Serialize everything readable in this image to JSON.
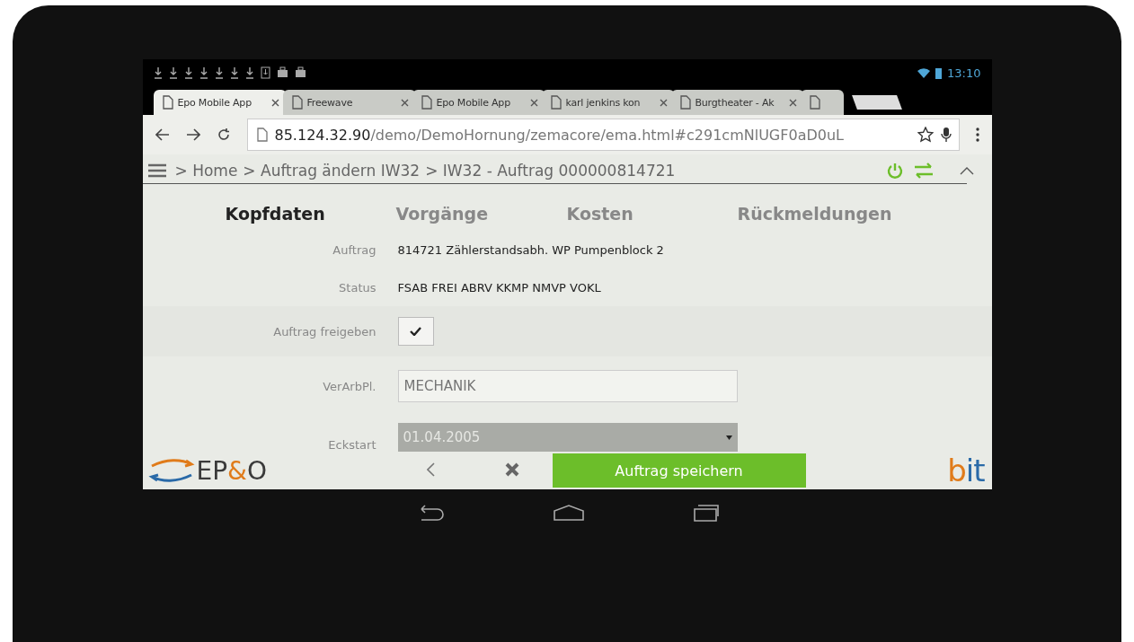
{
  "status_bar": {
    "time": "13:10"
  },
  "tabs": [
    {
      "label": "Epo Mobile App",
      "selected": true
    },
    {
      "label": "Freewave",
      "selected": false
    },
    {
      "label": "Epo Mobile App",
      "selected": false
    },
    {
      "label": "karl jenkins kon",
      "selected": false
    },
    {
      "label": "Burgtheater - Ak",
      "selected": false
    }
  ],
  "address_bar": {
    "host": "85.124.32.90",
    "path": "/demo/DemoHornung/zemacore/ema.html#c291cmNlUGF0aD0uL"
  },
  "breadcrumb": [
    "> Home",
    "> Auftrag ändern IW32",
    "> IW32 - Auftrag 000000814721"
  ],
  "sections": [
    {
      "label": "Kopfdaten",
      "selected": true
    },
    {
      "label": "Vorgänge",
      "selected": false
    },
    {
      "label": "Kosten",
      "selected": false
    },
    {
      "label": "Rückmeldungen",
      "selected": false
    }
  ],
  "fields": [
    {
      "kind": "text",
      "label": "Auftrag",
      "value": "814721 Zählerstandsabh. WP Pumpenblock 2"
    },
    {
      "kind": "text",
      "label": "Status",
      "value": "FSAB FREI ABRV KKMP NMVP VOKL"
    },
    {
      "kind": "checkbox",
      "label": "Auftrag freigeben",
      "checked": true
    },
    {
      "kind": "input",
      "label": "VerArbPl.",
      "placeholder": "MECHANIK"
    },
    {
      "kind": "select",
      "label": "Eckstart",
      "value": "01.04.2005",
      "disabled": true
    }
  ],
  "footer": {
    "logo_left": [
      {
        "text": "EP",
        "kind": "dark"
      },
      {
        "text": "&",
        "kind": "accent"
      },
      {
        "text": "O",
        "kind": "dark"
      }
    ],
    "save_button": "Auftrag speichern",
    "logo_right": [
      {
        "text": "b",
        "kind": "accent"
      },
      {
        "text": "it",
        "kind": "blue"
      }
    ]
  }
}
